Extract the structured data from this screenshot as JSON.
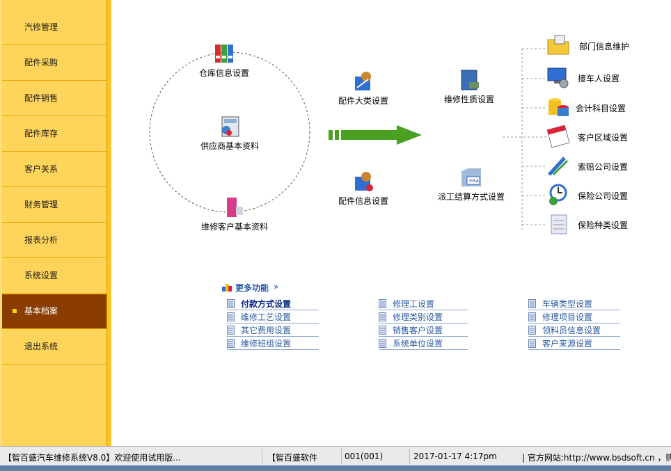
{
  "sidebar": {
    "items": [
      {
        "label": "汽修管理"
      },
      {
        "label": "配件采购"
      },
      {
        "label": "配件销售"
      },
      {
        "label": "配件库存"
      },
      {
        "label": "客户关系"
      },
      {
        "label": "财务管理"
      },
      {
        "label": "报表分析"
      },
      {
        "label": "系统设置"
      },
      {
        "label": "基本档案"
      },
      {
        "label": "退出系统"
      }
    ],
    "active": "基本档案"
  },
  "circle_nodes": {
    "warehouse": "仓库信息设置",
    "supplier": "供应商基本资料",
    "customer": "维修客户基本资料"
  },
  "middle_nodes": {
    "parts_category": "配件大类设置",
    "parts_info": "配件信息设置",
    "repair_nature": "维修性质设置",
    "settlement": "派工结算方式设置"
  },
  "right_nodes": {
    "dept": "部门信息维护",
    "receptionist": "接车人设置",
    "accounting": "会计科目设置",
    "region": "客户区域设置",
    "claim_company": "索赔公司设置",
    "insurance_company": "保险公司设置",
    "insurance_type": "保险种类设置"
  },
  "more": {
    "title": "更多功能",
    "links": [
      [
        "付款方式设置",
        "修理工设置",
        "车辆类型设置"
      ],
      [
        "维修工艺设置",
        "修理类别设置",
        "修理项目设置"
      ],
      [
        "其它费用设置",
        "销售客户设置",
        "领料员信息设置"
      ],
      [
        "维修班组设置",
        "系统单位设置",
        "客户来源设置"
      ]
    ]
  },
  "status": {
    "app": "【智百盛汽车维修系统V8.0】欢迎使用试用版...",
    "company": "【智百盛软件",
    "user": "001(001)",
    "datetime": "2017-01-17 4:17pm",
    "website": "| 官方网站:http://www.bsdsoft.cn ，购"
  },
  "colors": {
    "sidebar": "#ffd45a",
    "active": "#8b3d00",
    "arrow": "#4aa020",
    "link": "#2a5aa0"
  }
}
